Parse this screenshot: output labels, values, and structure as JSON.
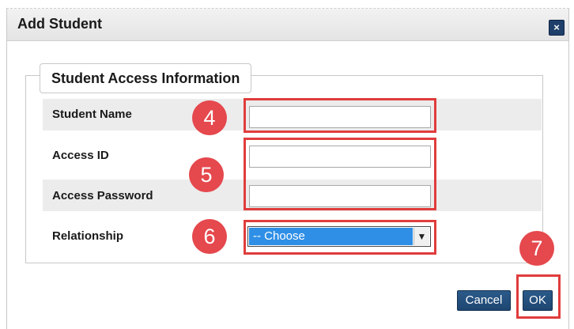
{
  "dialog": {
    "title": "Add Student",
    "close_icon": "×"
  },
  "section": {
    "legend": "Student Access Information"
  },
  "fields": {
    "student_name": {
      "label": "Student Name",
      "value": ""
    },
    "access_id": {
      "label": "Access ID",
      "value": ""
    },
    "access_password": {
      "label": "Access Password",
      "value": ""
    },
    "relationship": {
      "label": "Relationship",
      "selected": "-- Choose",
      "arrow": "▼"
    }
  },
  "callouts": {
    "c4": "4",
    "c5": "5",
    "c6": "6",
    "c7": "7"
  },
  "buttons": {
    "cancel": "Cancel",
    "ok": "OK"
  },
  "colors": {
    "callout_red": "#e03c3c",
    "button_blue": "#1e4672",
    "select_highlight": "#2f8fe6"
  }
}
